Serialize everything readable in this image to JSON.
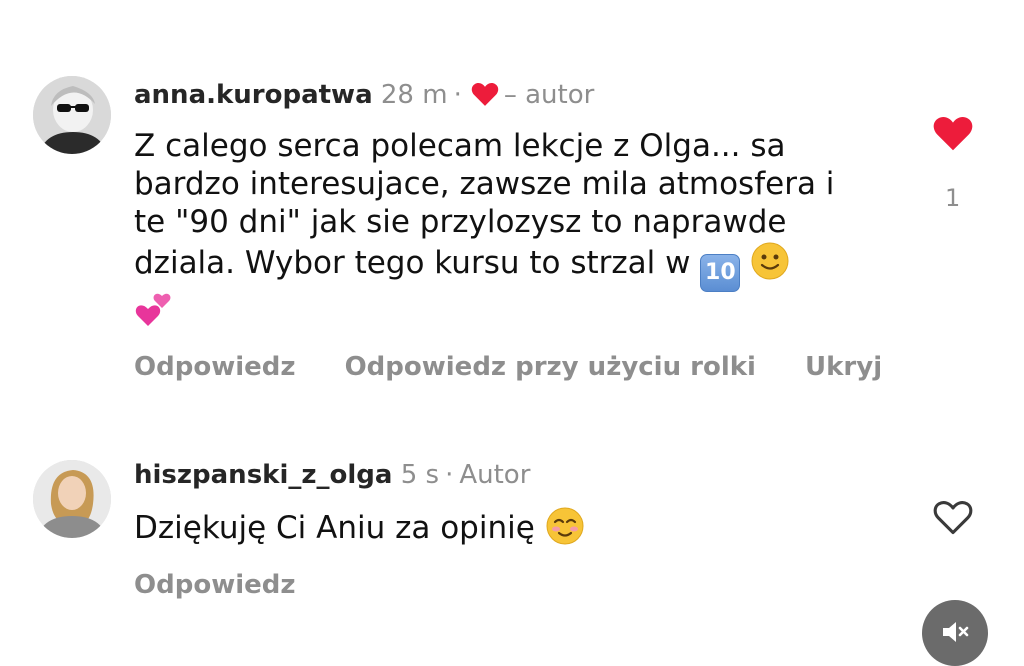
{
  "comments": [
    {
      "username": "anna.kuropatwa",
      "time": "28 m",
      "author_tag": "– autor",
      "line1": "Z calego serca polecam lekcje z Olga... sa",
      "line2": "bardzo interesujace, zawsze mila atmosfera i",
      "line3": "te \"90 dni\" jak sie przylozysz to naprawde",
      "line4": "dziala. Wybor tego kursu to strzal w",
      "keycap": "10",
      "emojis": [
        "keycap-ten",
        "slightly-smiling-face",
        "two-hearts"
      ],
      "likes": "1",
      "liked": true,
      "actions": {
        "reply": "Odpowiedz",
        "reply_reel": "Odpowiedz przy użyciu rolki",
        "hide": "Ukryj"
      }
    },
    {
      "username": "hiszpanski_z_olga",
      "time": "5 s",
      "author_tag": "Autor",
      "text": "Dziękuję Ci Aniu za opinię",
      "emojis": [
        "smiling-face"
      ],
      "liked": false,
      "actions": {
        "reply": "Odpowiedz"
      }
    }
  ],
  "icons": {
    "like_filled": "heart-filled-icon",
    "like_outline": "heart-outline-icon",
    "sound": "speaker-muted-icon"
  },
  "colors": {
    "like_red": "#ed1c3b",
    "meta_gray": "#8e8e8e",
    "text": "#111111"
  }
}
